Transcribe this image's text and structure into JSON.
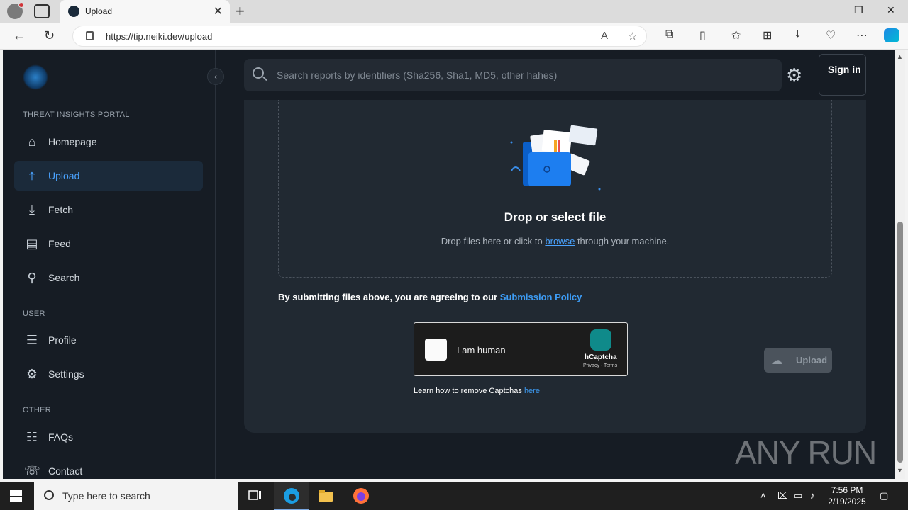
{
  "browser": {
    "tab_title": "Upload",
    "url": "https://tip.neiki.dev/upload"
  },
  "sidebar": {
    "section_portal": "THREAT INSIGHTS PORTAL",
    "section_user": "USER",
    "section_other": "OTHER",
    "items": [
      {
        "label": "Homepage",
        "icon": "home-icon"
      },
      {
        "label": "Upload",
        "icon": "upload-icon",
        "active": true
      },
      {
        "label": "Fetch",
        "icon": "download-icon"
      },
      {
        "label": "Feed",
        "icon": "feed-icon"
      },
      {
        "label": "Search",
        "icon": "search-icon"
      },
      {
        "label": "Profile",
        "icon": "profile-icon"
      },
      {
        "label": "Settings",
        "icon": "gear-icon"
      },
      {
        "label": "FAQs",
        "icon": "faq-icon"
      },
      {
        "label": "Contact",
        "icon": "contact-icon"
      }
    ]
  },
  "header": {
    "search_placeholder": "Search reports by identifiers (Sha256, Sha1, MD5, other hahes)",
    "signin_label": "Sign in"
  },
  "upload": {
    "drop_title": "Drop or select file",
    "drop_sub_prefix": "Drop files here or click to",
    "drop_sub_link": "browse",
    "drop_sub_suffix": "through your machine.",
    "policy_prefix": "By submitting files above, you are agreeing to our",
    "policy_link": "Submission Policy",
    "captcha_label": "I am human",
    "captcha_brand": "hCaptcha",
    "captcha_terms": "Privacy - Terms",
    "learn_prefix": "Learn how to remove Captchas",
    "learn_link": "here",
    "upload_button": "Upload"
  },
  "watermark": "ANY RUN",
  "taskbar": {
    "search_placeholder": "Type here to search",
    "time": "7:56 PM",
    "date": "2/19/2025"
  },
  "colors": {
    "accent": "#4aa3ff",
    "page_bg": "#161c24",
    "card_bg": "#212932"
  }
}
